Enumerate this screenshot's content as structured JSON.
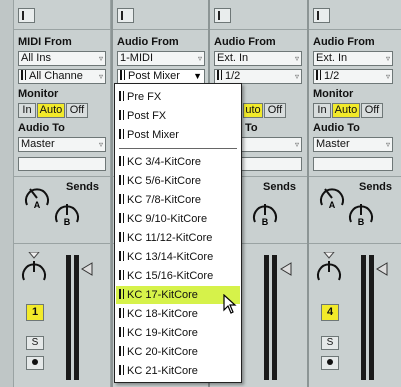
{
  "tracks": [
    {
      "input_label": "MIDI From",
      "input_type": "All Ins",
      "input_channel": "All Channe",
      "monitor_label": "Monitor",
      "monitor_in": "In",
      "monitor_auto": "Auto",
      "monitor_off": "Off",
      "output_label": "Audio To",
      "output_value": "Master",
      "sends_label": "Sends",
      "send_a": "A",
      "send_b": "B",
      "track_number": "1",
      "solo_label": "S"
    },
    {
      "input_label": "Audio From",
      "input_type": "1-MIDI",
      "input_channel": "Post Mixer"
    },
    {
      "input_label": "Audio From",
      "input_type": "Ext. In",
      "input_channel": "1/2",
      "monitor_auto_partial": "uto",
      "monitor_off": "Off",
      "output_label_partial": "To",
      "sends_label": "Sends",
      "send_b": "B"
    },
    {
      "input_label": "Audio From",
      "input_type": "Ext. In",
      "input_channel": "1/2",
      "monitor_label": "Monitor",
      "monitor_in": "In",
      "monitor_auto": "Auto",
      "monitor_off": "Off",
      "output_label": "Audio To",
      "output_value": "Master",
      "sends_label": "Sends",
      "send_a": "A",
      "send_b": "B",
      "track_number": "4",
      "solo_label": "S"
    }
  ],
  "menu": {
    "items": [
      "Pre FX",
      "Post FX",
      "Post Mixer",
      "KC 3/4-KitCore",
      "KC 5/6-KitCore",
      "KC 7/8-KitCore",
      "KC 9/10-KitCore",
      "KC 11/12-KitCore",
      "KC 13/14-KitCore",
      "KC 15/16-KitCore",
      "KC 17-KitCore",
      "KC 18-KitCore",
      "KC 19-KitCore",
      "KC 20-KitCore",
      "KC 21-KitCore"
    ],
    "selected": "KC 17-KitCore"
  },
  "colors": {
    "panel": "#c9d0d0",
    "highlight": "#f2ea2a",
    "menu_selected": "#d6f24a"
  },
  "icons": {
    "knob": "knob-icon",
    "volume": "volume-knob-icon",
    "meter_arrow": "meter-arrow-icon",
    "cursor": "arrow-cursor-icon"
  }
}
